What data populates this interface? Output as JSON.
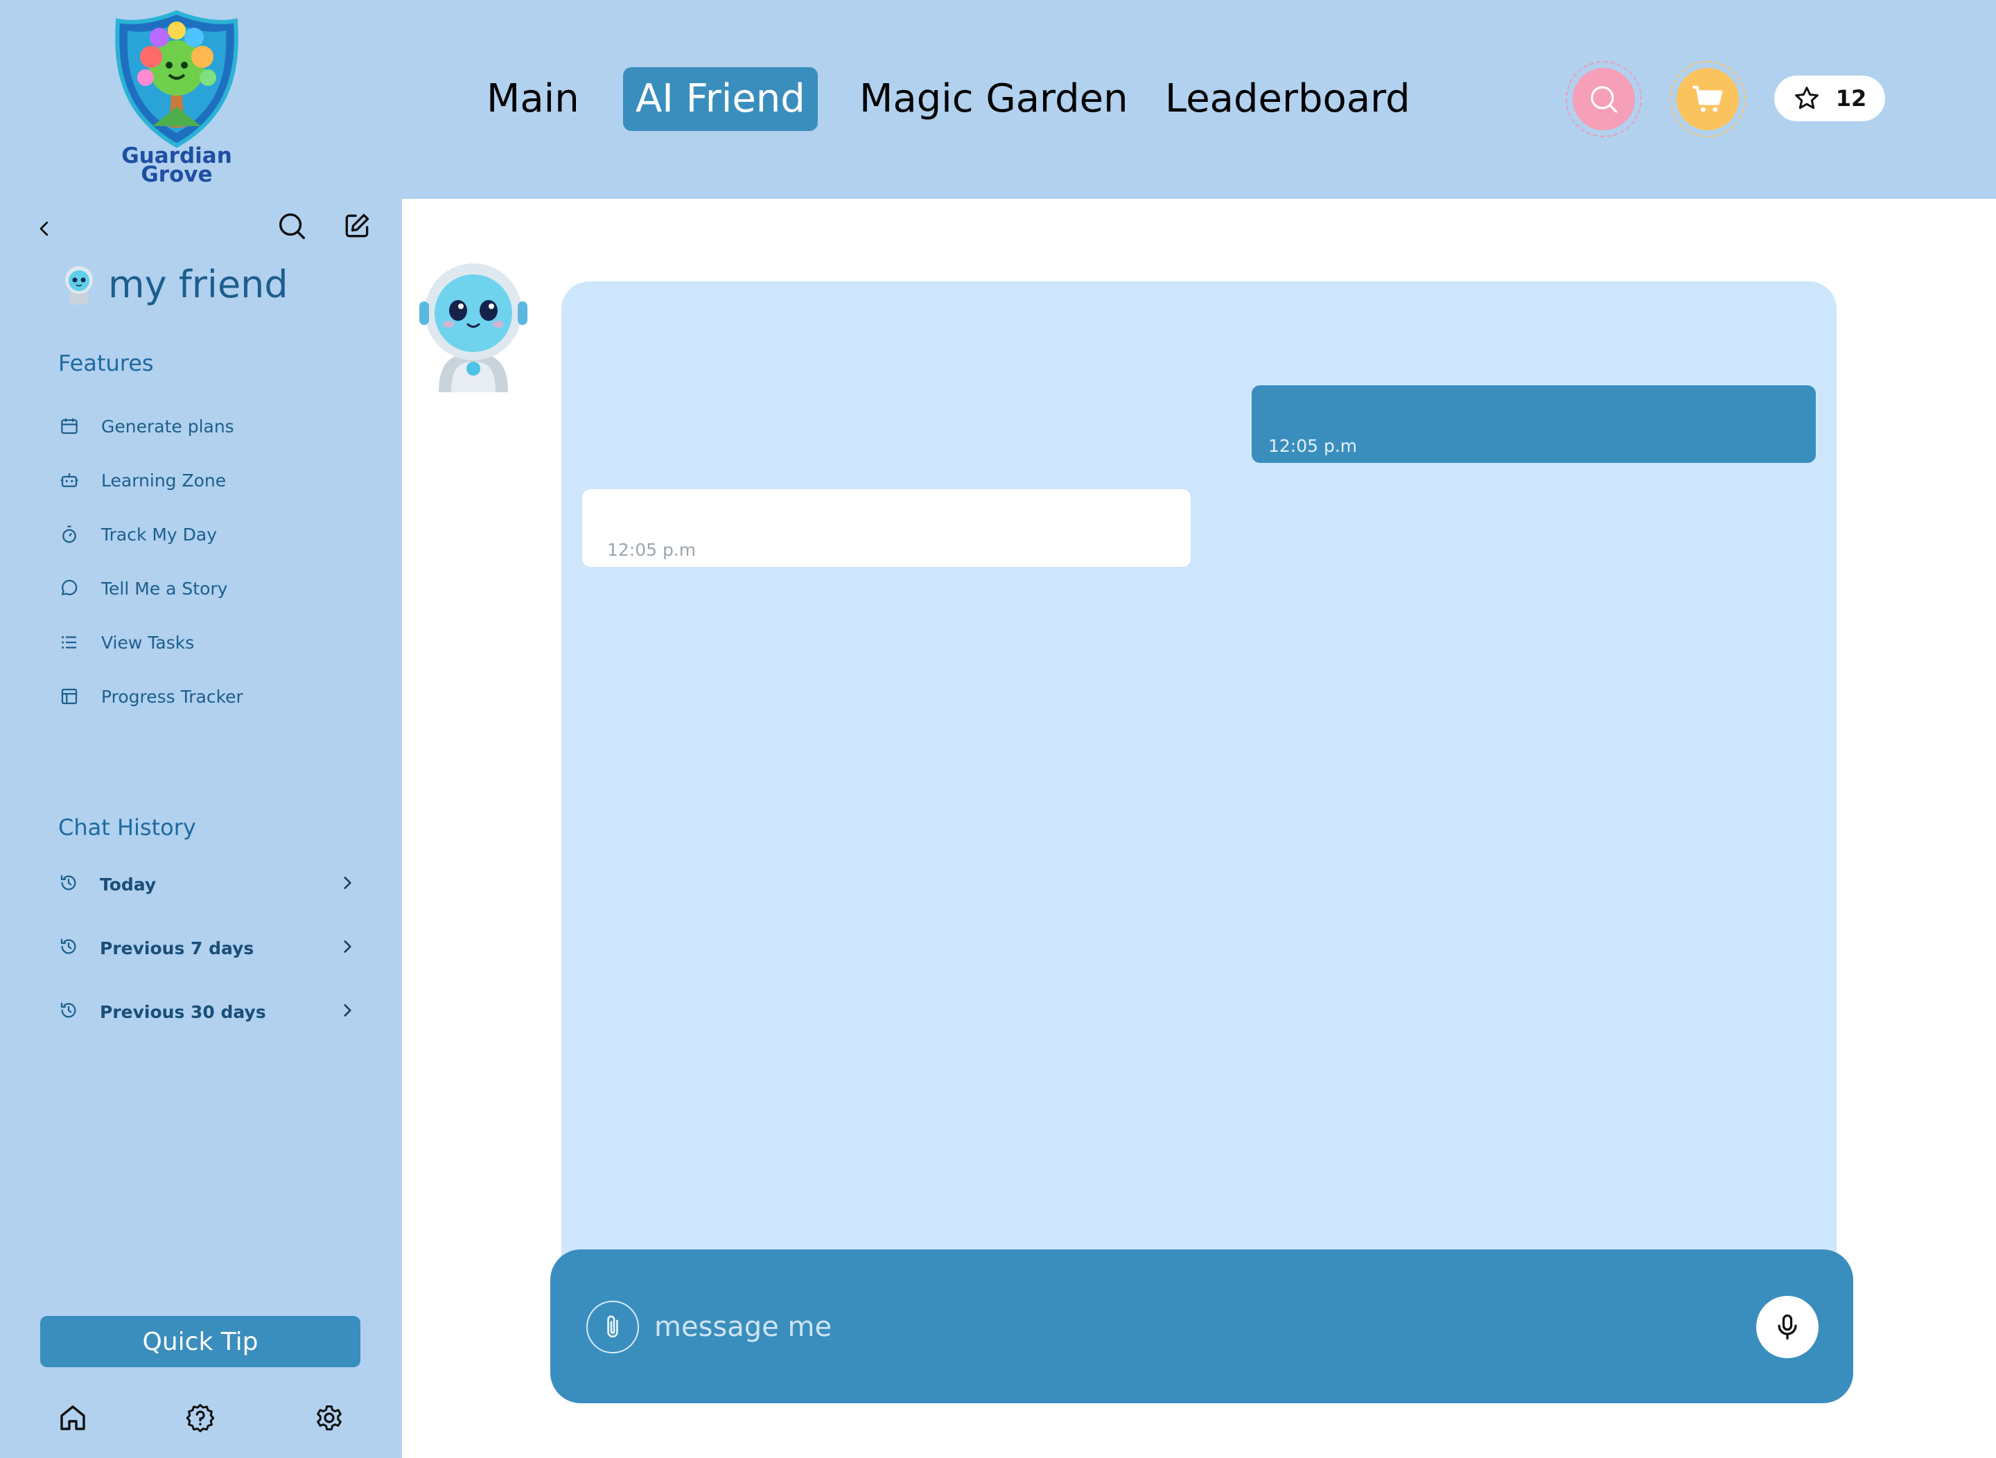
{
  "brand": {
    "logo_text": "Guardian Grove"
  },
  "nav": {
    "items": [
      {
        "label": "Main"
      },
      {
        "label": "AI Friend"
      },
      {
        "label": "Magic Garden"
      },
      {
        "label": "Leaderboard"
      }
    ],
    "active": "AI Friend"
  },
  "header_actions": {
    "search_icon": "search-icon",
    "cart_icon": "cart-icon",
    "star_icon": "star-icon",
    "stars_count": "12"
  },
  "sidebar": {
    "title": "my friend",
    "features_title": "Features",
    "features": [
      {
        "label": "Generate plans",
        "icon": "calendar-icon"
      },
      {
        "label": "Learning Zone",
        "icon": "robot-icon"
      },
      {
        "label": "Track My Day",
        "icon": "stopwatch-icon"
      },
      {
        "label": "Tell Me a Story",
        "icon": "chat-bubble-icon"
      },
      {
        "label": "View Tasks",
        "icon": "list-icon"
      },
      {
        "label": "Progress Tracker",
        "icon": "layout-icon"
      }
    ],
    "history_title": "Chat History",
    "history": [
      {
        "label": "Today",
        "icon": "history-icon"
      },
      {
        "label": "Previous 7 days",
        "icon": "history-icon"
      },
      {
        "label": "Previous 30 days",
        "icon": "history-icon"
      }
    ],
    "quick_tip": "Quick Tip",
    "bottom_icons": [
      "home-icon",
      "help-icon",
      "settings-icon"
    ]
  },
  "chat": {
    "messages": [
      {
        "from": "user",
        "text": "",
        "time": "12:05 p.m"
      },
      {
        "from": "ai",
        "text": "",
        "time": "12:05 p.m"
      }
    ],
    "input_placeholder": "message me"
  },
  "colors": {
    "header_bg": "#b1d1ef",
    "accent": "#3a8ebd",
    "chat_bg": "#cde6fc",
    "search_btn": "#f59fb8",
    "cart_btn": "#fbc35d"
  }
}
